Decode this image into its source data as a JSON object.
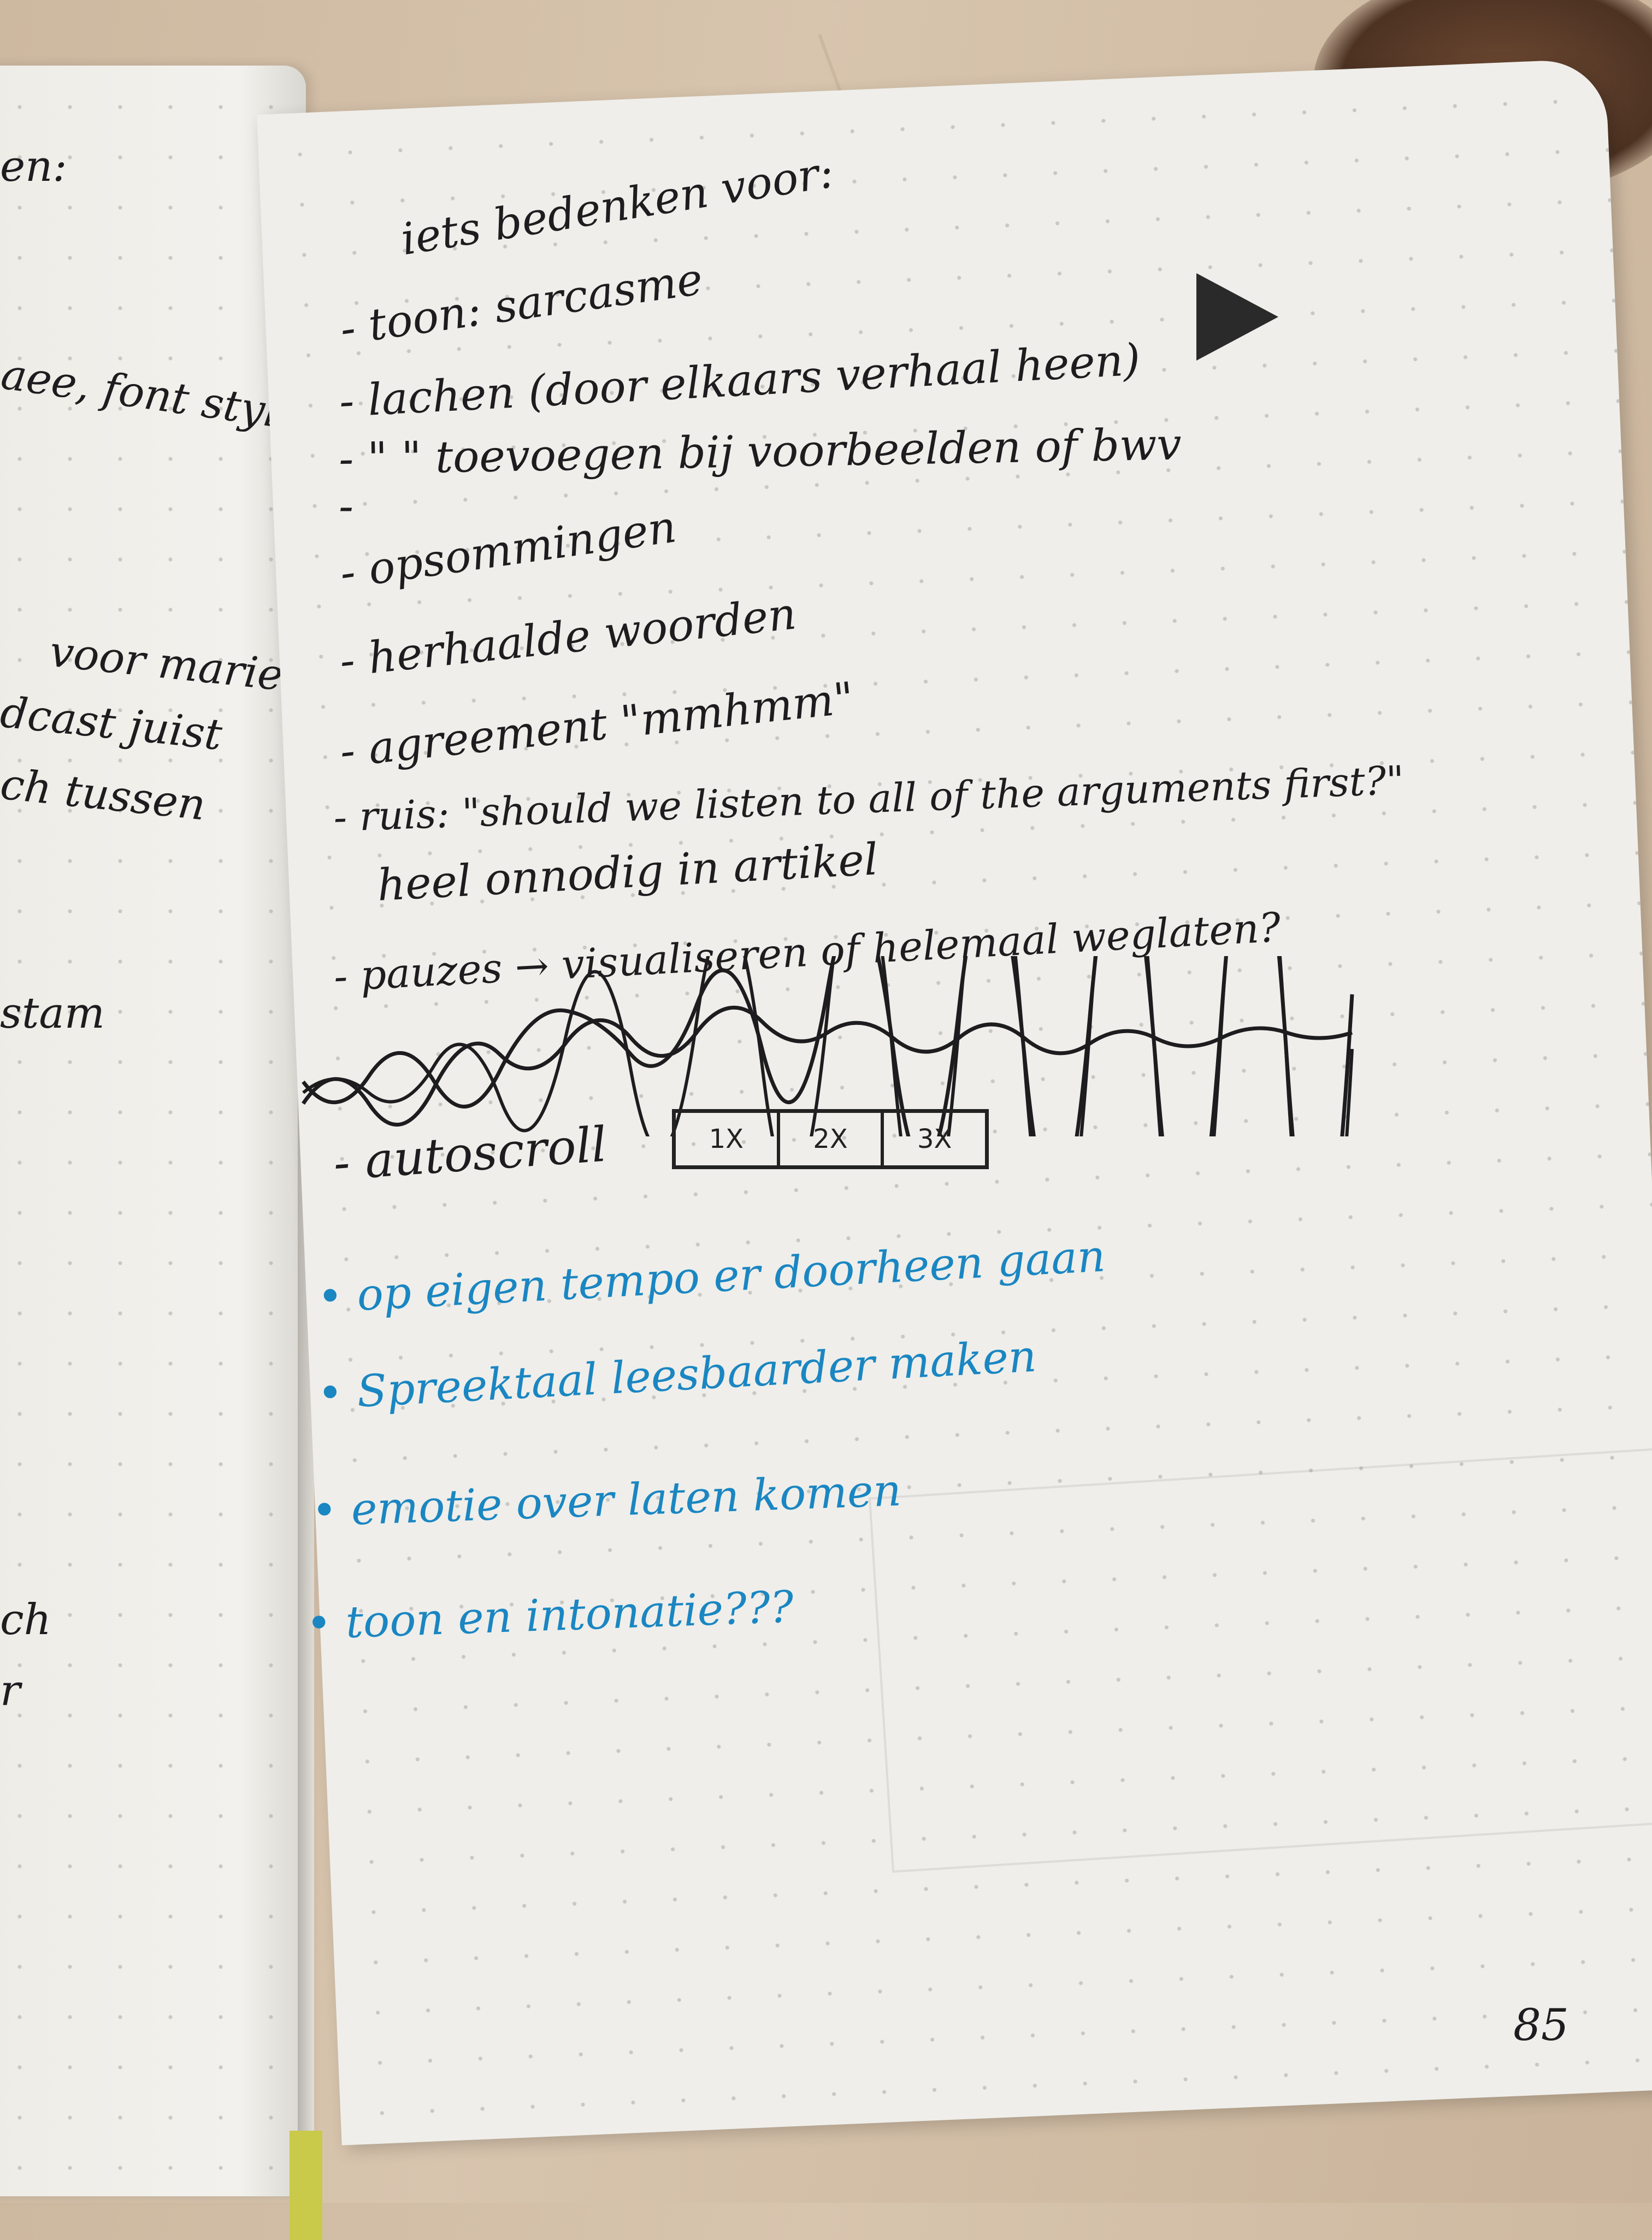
{
  "left_page": {
    "lines": [
      {
        "text": "en:"
      },
      {
        "text": "aee, font style,"
      },
      {
        "text": "voor marie"
      },
      {
        "text": "dcast juist"
      },
      {
        "text": "ch tussen"
      },
      {
        "text": "stam"
      },
      {
        "text": "ch"
      },
      {
        "text": "r"
      }
    ]
  },
  "right_page": {
    "heading": "iets bedenken voor:",
    "items": [
      "- toon: sarcasme",
      "- lachen (door elkaars verhaal heen)",
      "- \" \" toevoegen bij voorbeelden of bwv",
      "-",
      "- opsommingen",
      "- herhaalde woorden",
      "- agreement \"mmhmm\"",
      "- ruis: \"should we listen to all of the arguments first?\"",
      "heel onnodig in artikel",
      "- pauzes → visualiseren of helemaal weglaten?"
    ],
    "autoscroll_label": "- autoscroll",
    "speed_options": [
      "1X",
      "2X",
      "3X"
    ],
    "blue_items": [
      "• op eigen tempo er doorheen gaan",
      "• Spreektaal leesbaarder maken",
      "• emotie over laten komen",
      "• toon en intonatie???"
    ],
    "page_number": "85"
  },
  "colors": {
    "ink_black": "#1d1d1f",
    "ink_blue": "#1a86c2",
    "paper": "#efeeea"
  }
}
